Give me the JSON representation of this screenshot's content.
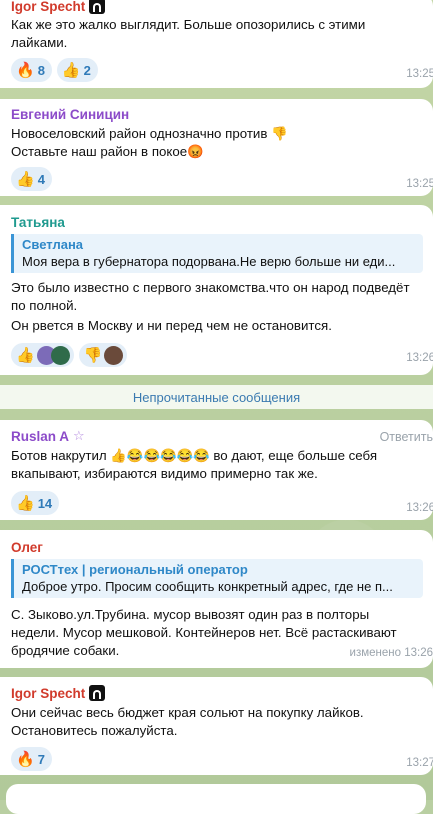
{
  "colors": {
    "name_red": "#d13b2c",
    "name_purple": "#8c4bc9",
    "name_teal": "#1f9a8f",
    "accent_blue": "#3a95d6",
    "reaction_text": "#2f7ab8"
  },
  "messages": [
    {
      "sender": "Igor Specht",
      "text": "Как же это жалко выглядит. Больше опозорились с этими лайками.",
      "reactions": [
        {
          "emoji": "🔥",
          "count": "8"
        },
        {
          "emoji": "👍",
          "count": "2"
        }
      ],
      "time": "13:25"
    },
    {
      "sender": "Евгений Синицин",
      "text": "Новоселовский район однозначно против 👎 Оставьте наш район в покое😡",
      "reactions": [
        {
          "emoji": "👍",
          "count": "4"
        }
      ],
      "time": "13:25"
    },
    {
      "sender": "Татьяна",
      "quote_author": "Светлана",
      "quote_text": "Моя вера в губернатора подорвана.Не верю больше ни еди...",
      "text1": "Это было известно с первого знакомства.что он народ подведёт по полной.",
      "text2": "Он рвется в Москву и ни перед чем не остановится.",
      "reactions": [
        {
          "emoji": "👍"
        },
        {
          "emoji": "👎"
        }
      ],
      "time": "13:26"
    },
    {
      "sender": "Ruslan A",
      "sender_icon": "star-icon",
      "reply_label": "Ответить",
      "text": "Ботов накрутил 👍😂😂😂😂😂 во дают, еще больше себя вкапывают, избираются видимо примерно так же.",
      "reactions": [
        {
          "emoji": "👍",
          "count": "14"
        }
      ],
      "time": "13:26"
    },
    {
      "sender": "Олег",
      "quote_author": "РОСТтех | региональный оператор",
      "quote_text": "Доброе утро. Просим сообщить конкретный адрес, где не п...",
      "text": "С. Зыково.ул.Трубина. мусор вывозят один раз в полторы недели. Мусор мешковой. Контейнеров нет. Всё растаскивают бродячие собаки.",
      "edited_time": "изменено 13:26"
    },
    {
      "sender": "Igor Specht",
      "text": "Они сейчас весь бюджет края сольют на покупку лайков. Остановитесь пожалуйста.",
      "reactions": [
        {
          "emoji": "🔥",
          "count": "7"
        }
      ],
      "time": "13:27"
    }
  ],
  "unread_label": "Непрочитанные сообщения"
}
